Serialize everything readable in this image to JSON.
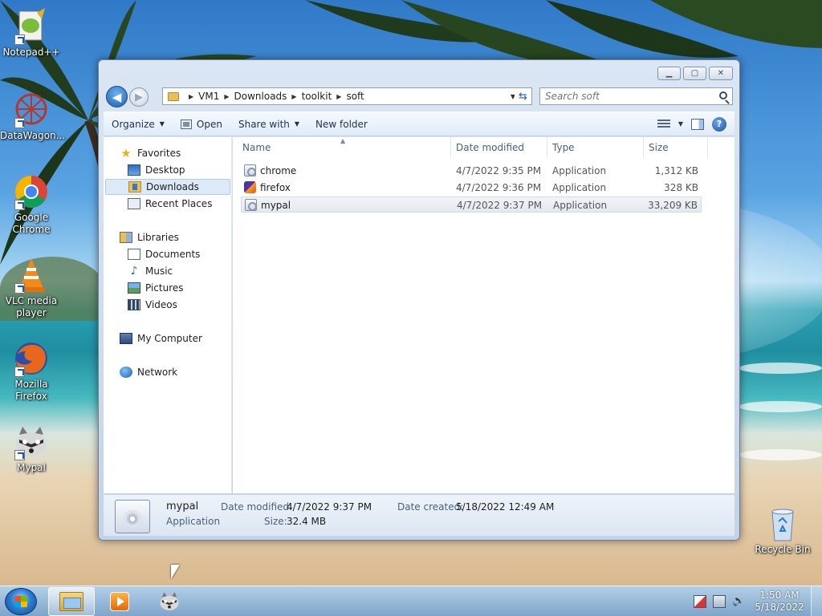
{
  "desktop": {
    "icons": [
      {
        "label": "Notepad++"
      },
      {
        "label": "DataWagon..."
      },
      {
        "label": "Google\nChrome"
      },
      {
        "label": "VLC media\nplayer"
      },
      {
        "label": "Mozilla\nFirefox"
      },
      {
        "label": "Mypal"
      },
      {
        "label": "Recycle Bin"
      }
    ]
  },
  "window": {
    "caption_buttons": {
      "minimize": "▁",
      "maximize": "▢",
      "close": "✕"
    },
    "nav": {
      "back": "◀",
      "forward": "▶"
    },
    "address": {
      "crumbs": [
        "VM1",
        "Downloads",
        "toolkit",
        "soft"
      ]
    },
    "search": {
      "placeholder": "Search soft"
    },
    "toolbar": {
      "organize": "Organize",
      "open": "Open",
      "share_with": "Share with",
      "new_folder": "New folder",
      "help": "?"
    },
    "nav_pane": {
      "favorites": "Favorites",
      "desktop": "Desktop",
      "downloads": "Downloads",
      "recent_places": "Recent Places",
      "libraries": "Libraries",
      "documents": "Documents",
      "music": "Music",
      "pictures": "Pictures",
      "videos": "Videos",
      "my_computer": "My Computer",
      "network": "Network"
    },
    "columns": {
      "name": "Name",
      "date_modified": "Date modified",
      "type": "Type",
      "size": "Size"
    },
    "files": [
      {
        "name": "chrome",
        "date": "4/7/2022 9:35 PM",
        "type": "Application",
        "size": "1,312 KB"
      },
      {
        "name": "firefox",
        "date": "4/7/2022 9:36 PM",
        "type": "Application",
        "size": "328 KB"
      },
      {
        "name": "mypal",
        "date": "4/7/2022 9:37 PM",
        "type": "Application",
        "size": "33,209 KB"
      }
    ],
    "selected_file": 2,
    "details": {
      "name": "mypal",
      "type": "Application",
      "date_modified_label": "Date modified:",
      "date_modified": "4/7/2022 9:37 PM",
      "date_created_label": "Date created:",
      "date_created": "5/18/2022 12:49 AM",
      "size_label": "Size:",
      "size": "32.4 MB"
    }
  },
  "taskbar": {
    "time": "1:50 AM",
    "date": "5/18/2022"
  }
}
